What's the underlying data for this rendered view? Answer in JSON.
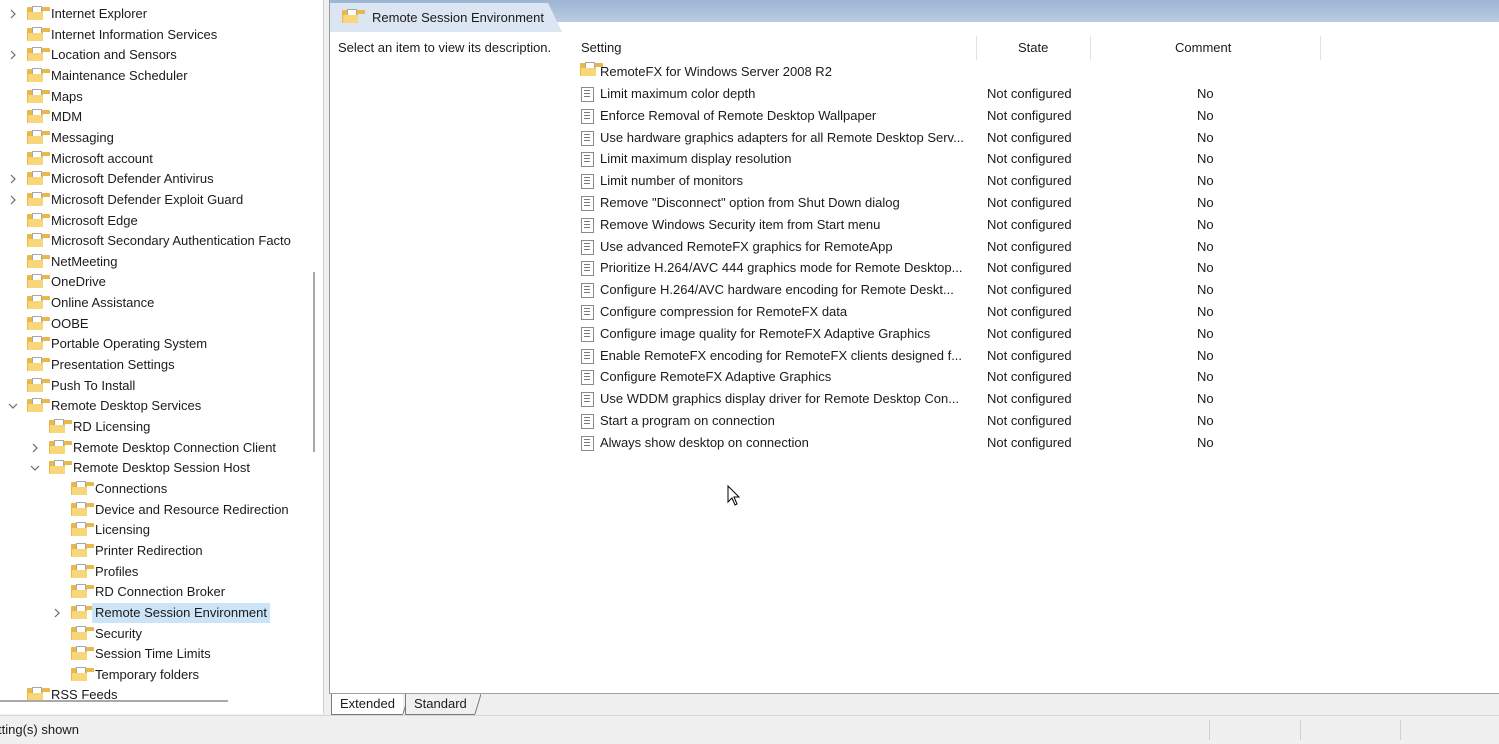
{
  "tree": {
    "items": [
      {
        "label": "Internet Explorer",
        "expander": ">"
      },
      {
        "label": "Internet Information Services",
        "expander": ""
      },
      {
        "label": "Location and Sensors",
        "expander": ">"
      },
      {
        "label": "Maintenance Scheduler",
        "expander": ""
      },
      {
        "label": "Maps",
        "expander": ""
      },
      {
        "label": "MDM",
        "expander": ""
      },
      {
        "label": "Messaging",
        "expander": ""
      },
      {
        "label": "Microsoft account",
        "expander": ""
      },
      {
        "label": "Microsoft Defender Antivirus",
        "expander": ">"
      },
      {
        "label": "Microsoft Defender Exploit Guard",
        "expander": ">"
      },
      {
        "label": "Microsoft Edge",
        "expander": ""
      },
      {
        "label": "Microsoft Secondary Authentication Facto",
        "expander": ""
      },
      {
        "label": "NetMeeting",
        "expander": ""
      },
      {
        "label": "OneDrive",
        "expander": ""
      },
      {
        "label": "Online Assistance",
        "expander": ""
      },
      {
        "label": "OOBE",
        "expander": ""
      },
      {
        "label": "Portable Operating System",
        "expander": ""
      },
      {
        "label": "Presentation Settings",
        "expander": ""
      },
      {
        "label": "Push To Install",
        "expander": ""
      },
      {
        "label": "Remote Desktop Services",
        "expander": "v"
      },
      {
        "label": "RD Licensing",
        "expander": ""
      },
      {
        "label": "Remote Desktop Connection Client",
        "expander": ">"
      },
      {
        "label": "Remote Desktop Session Host",
        "expander": "v"
      },
      {
        "label": "Connections",
        "expander": ""
      },
      {
        "label": "Device and Resource Redirection",
        "expander": ""
      },
      {
        "label": "Licensing",
        "expander": ""
      },
      {
        "label": "Printer Redirection",
        "expander": ""
      },
      {
        "label": "Profiles",
        "expander": ""
      },
      {
        "label": "RD Connection Broker",
        "expander": ""
      },
      {
        "label": "Remote Session Environment",
        "expander": ">"
      },
      {
        "label": "Security",
        "expander": ""
      },
      {
        "label": "Session Time Limits",
        "expander": ""
      },
      {
        "label": "Temporary folders",
        "expander": ""
      },
      {
        "label": "RSS Feeds",
        "expander": ""
      }
    ]
  },
  "panel": {
    "title": "Remote Session Environment",
    "description": "Select an item to view its description."
  },
  "list": {
    "headers": {
      "setting": "Setting",
      "state": "State",
      "comment": "Comment"
    },
    "folder_row": "RemoteFX for Windows Server 2008 R2",
    "rows": [
      {
        "name": "Limit maximum color depth",
        "state": "Not configured",
        "comment": "No"
      },
      {
        "name": "Enforce Removal of Remote Desktop Wallpaper",
        "state": "Not configured",
        "comment": "No"
      },
      {
        "name": "Use hardware graphics adapters for all Remote Desktop Serv...",
        "state": "Not configured",
        "comment": "No"
      },
      {
        "name": "Limit maximum display resolution",
        "state": "Not configured",
        "comment": "No"
      },
      {
        "name": "Limit number of monitors",
        "state": "Not configured",
        "comment": "No"
      },
      {
        "name": "Remove \"Disconnect\" option from Shut Down dialog",
        "state": "Not configured",
        "comment": "No"
      },
      {
        "name": "Remove Windows Security item from Start menu",
        "state": "Not configured",
        "comment": "No"
      },
      {
        "name": "Use advanced RemoteFX graphics for RemoteApp",
        "state": "Not configured",
        "comment": "No"
      },
      {
        "name": "Prioritize H.264/AVC 444 graphics mode for Remote Desktop...",
        "state": "Not configured",
        "comment": "No"
      },
      {
        "name": "Configure H.264/AVC hardware encoding for Remote Deskt...",
        "state": "Not configured",
        "comment": "No"
      },
      {
        "name": "Configure compression for RemoteFX data",
        "state": "Not configured",
        "comment": "No"
      },
      {
        "name": "Configure image quality for RemoteFX Adaptive Graphics",
        "state": "Not configured",
        "comment": "No"
      },
      {
        "name": "Enable RemoteFX encoding for RemoteFX clients designed f...",
        "state": "Not configured",
        "comment": "No"
      },
      {
        "name": "Configure RemoteFX Adaptive Graphics",
        "state": "Not configured",
        "comment": "No"
      },
      {
        "name": "Use WDDM graphics display driver for Remote Desktop Con...",
        "state": "Not configured",
        "comment": "No"
      },
      {
        "name": "Start a program on connection",
        "state": "Not configured",
        "comment": "No"
      },
      {
        "name": "Always show desktop on connection",
        "state": "Not configured",
        "comment": "No"
      }
    ]
  },
  "tabs": {
    "extended": "Extended",
    "standard": "Standard"
  },
  "status": {
    "text": "tting(s) shown"
  }
}
